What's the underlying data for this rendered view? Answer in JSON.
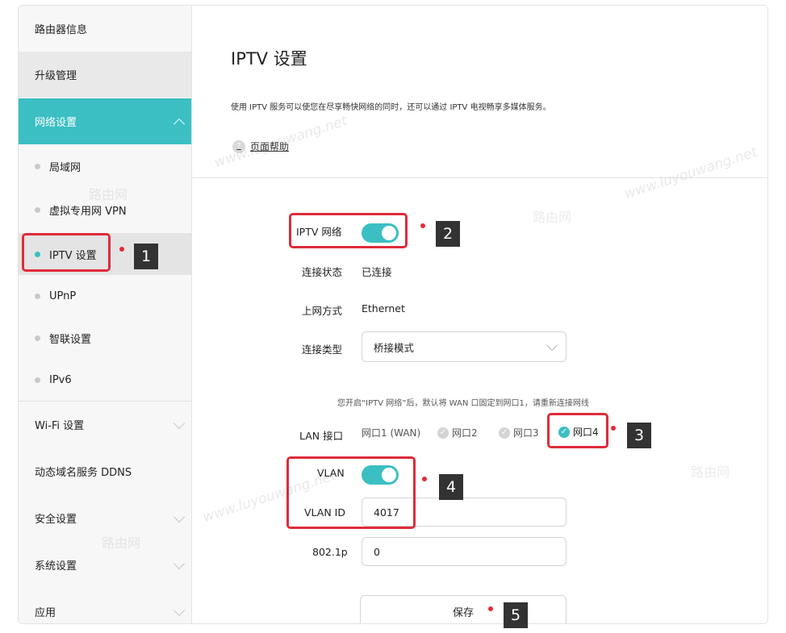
{
  "sidebar": {
    "items": [
      {
        "label": "路由器信息"
      },
      {
        "label": "升级管理"
      },
      {
        "label": "网络设置"
      }
    ],
    "sub_items": [
      {
        "label": "局域网"
      },
      {
        "label": "虚拟专用网 VPN"
      },
      {
        "label": "IPTV 设置"
      },
      {
        "label": "UPnP"
      },
      {
        "label": "智联设置"
      },
      {
        "label": "IPv6"
      }
    ],
    "lower_items": [
      {
        "label": "Wi-Fi 设置"
      },
      {
        "label": "动态域名服务 DDNS"
      },
      {
        "label": "安全设置"
      },
      {
        "label": "系统设置"
      },
      {
        "label": "应用"
      }
    ]
  },
  "page": {
    "title": "IPTV 设置",
    "description": "使用 IPTV 服务可以使您在尽享畅快网络的同时，还可以通过 IPTV 电视畅享多媒体服务。",
    "help_label": "页面帮助",
    "help_icon": "?"
  },
  "form": {
    "iptv_label": "IPTV 网络",
    "iptv_enabled": true,
    "status_label": "连接状态",
    "status_value": "已连接",
    "mode_label": "上网方式",
    "mode_value": "Ethernet",
    "type_label": "连接类型",
    "type_value": "桥接模式",
    "note": "您开启“IPTV 网络”后，默认将 WAN 口固定到网口1，请重新连接网线",
    "lan_label": "LAN 接口",
    "ports": [
      "网口1 (WAN)",
      "网口2",
      "网口3",
      "网口4"
    ],
    "selected_port": "网口4",
    "vlan_label": "VLAN",
    "vlan_enabled": true,
    "vlan_id_label": "VLAN ID",
    "vlan_id_value": "4017",
    "priority_label": "802.1p",
    "priority_value": "0",
    "save_label": "保存"
  },
  "markers": [
    "1",
    "2",
    "3",
    "4",
    "5"
  ],
  "watermarks": [
    "www.luyouwang.net",
    "路由网"
  ],
  "colors": {
    "accent": "#3bbfc3",
    "annotation": "#e02b3a",
    "marker_bg": "#333333"
  },
  "icons": {
    "check": "✓"
  }
}
